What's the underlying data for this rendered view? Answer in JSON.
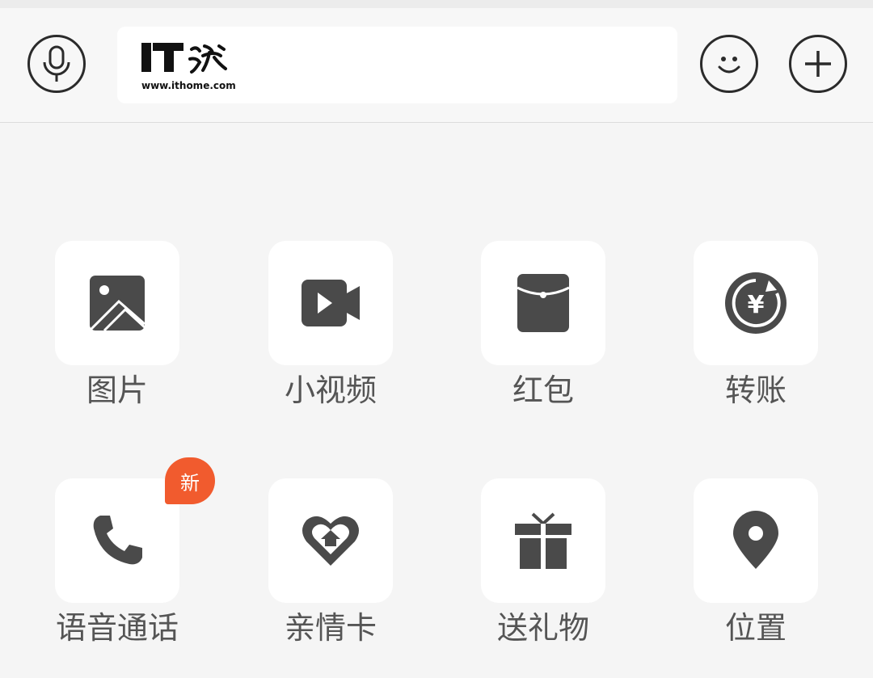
{
  "input_bar": {
    "voice_icon": "microphone-icon",
    "text_value": "",
    "emoji_icon": "smiley-icon",
    "more_icon": "plus-icon",
    "watermark": {
      "brand": "IT之家",
      "url": "www.ithome.com"
    }
  },
  "panel": {
    "items": [
      {
        "label": "图片",
        "icon": "image-icon"
      },
      {
        "label": "小视频",
        "icon": "video-camera-icon"
      },
      {
        "label": "红包",
        "icon": "red-envelope-icon"
      },
      {
        "label": "转账",
        "icon": "transfer-yuan-icon"
      },
      {
        "label": "语音通话",
        "icon": "phone-icon",
        "badge": "新"
      },
      {
        "label": "亲情卡",
        "icon": "family-card-heart-icon"
      },
      {
        "label": "送礼物",
        "icon": "gift-icon"
      },
      {
        "label": "位置",
        "icon": "location-pin-icon"
      }
    ]
  },
  "colors": {
    "icon": "#4a4a4a",
    "badge": "#f15b2e",
    "label": "#555555",
    "background": "#f5f5f5"
  }
}
